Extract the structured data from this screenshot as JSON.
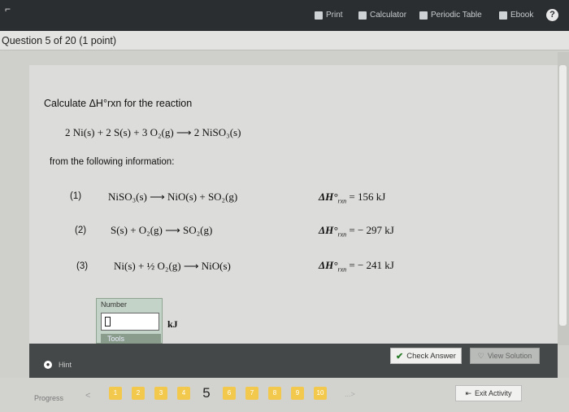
{
  "toolbar": {
    "print": "Print",
    "calculator": "Calculator",
    "periodic_table": "Periodic Table",
    "ebook": "Ebook",
    "help": "?"
  },
  "question": {
    "title": "Question 5 of 20 (1 point)",
    "prompt": "Calculate ΔH°rxn for the reaction",
    "target_reaction": "2 Ni(s)  +  2 S(s)  +  3 O₂(g)     ⟶   2 NiSO₃(s)",
    "info_label": "from the following information:"
  },
  "reactions": [
    {
      "label": "(1)",
      "equation": "NiSO₃(s)   ⟶   NiO(s)  +  SO₂(g)",
      "dh_symbol": "ΔH°",
      "dh_sub": "rxn",
      "dh_value": "=   156  kJ"
    },
    {
      "label": "(2)",
      "equation": "S(s)  +  O₂(g)   ⟶   SO₂(g)",
      "dh_symbol": "ΔH°",
      "dh_sub": "rxn",
      "dh_value": "=   − 297  kJ"
    },
    {
      "label": "(3)",
      "equation": "Ni(s)  +  ½  O₂(g)   ⟶   NiO(s)",
      "dh_symbol": "ΔH°",
      "dh_sub": "rxn",
      "dh_value": "=   − 241  kJ"
    }
  ],
  "answer": {
    "number_label": "Number",
    "value": "",
    "unit": "kJ",
    "tools_label": "Tools"
  },
  "footer": {
    "hint": "Hint",
    "check_answer": "Check Answer",
    "view_solution": "View Solution"
  },
  "progress": {
    "label": "Progress",
    "prev": "<",
    "pages": [
      "1",
      "2",
      "3",
      "4",
      "5",
      "6",
      "7",
      "8",
      "9",
      "10"
    ],
    "current": "5",
    "more": "...>",
    "exit": "Exit Activity"
  },
  "colors": {
    "topbar": "#2b2e31",
    "page_tile": "#f2c94c",
    "answer_box": "#c4d3c7"
  }
}
